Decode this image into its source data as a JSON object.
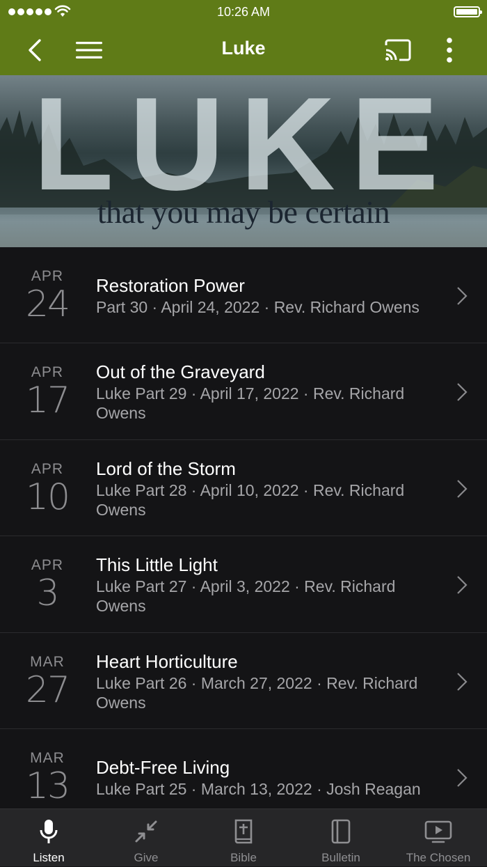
{
  "status_bar": {
    "time": "10:26 AM"
  },
  "nav": {
    "title": "Luke"
  },
  "hero": {
    "word": "LUKE",
    "subtitle": "that you may be certain"
  },
  "sermons": [
    {
      "month": "APR",
      "day": "24",
      "title": "Restoration Power",
      "subtitle": "Part 30 · April 24, 2022 · Rev. Richard Owens"
    },
    {
      "month": "APR",
      "day": "17",
      "title": "Out of the Graveyard",
      "subtitle": "Luke Part 29 · April 17, 2022 · Rev. Richard Owens"
    },
    {
      "month": "APR",
      "day": "10",
      "title": "Lord of the Storm",
      "subtitle": "Luke Part 28 · April 10, 2022 · Rev. Richard Owens"
    },
    {
      "month": "APR",
      "day": "3",
      "title": "This Little Light",
      "subtitle": "Luke Part 27 · April 3, 2022 · Rev. Richard Owens"
    },
    {
      "month": "MAR",
      "day": "27",
      "title": "Heart Horticulture",
      "subtitle": "Luke Part 26 · March 27, 2022 · Rev. Richard Owens"
    },
    {
      "month": "MAR",
      "day": "13",
      "title": "Debt-Free Living",
      "subtitle": "Luke Part 25 · March 13, 2022 · Josh Reagan"
    }
  ],
  "tabs": [
    {
      "label": "Listen",
      "icon": "microphone-icon",
      "active": true
    },
    {
      "label": "Give",
      "icon": "give-icon",
      "active": false
    },
    {
      "label": "Bible",
      "icon": "bible-icon",
      "active": false
    },
    {
      "label": "Bulletin",
      "icon": "bulletin-icon",
      "active": false
    },
    {
      "label": "The Chosen",
      "icon": "tv-play-icon",
      "active": false
    }
  ],
  "colors": {
    "nav_green": "#5f7b17",
    "background": "#141416",
    "tabbar": "#262628"
  }
}
